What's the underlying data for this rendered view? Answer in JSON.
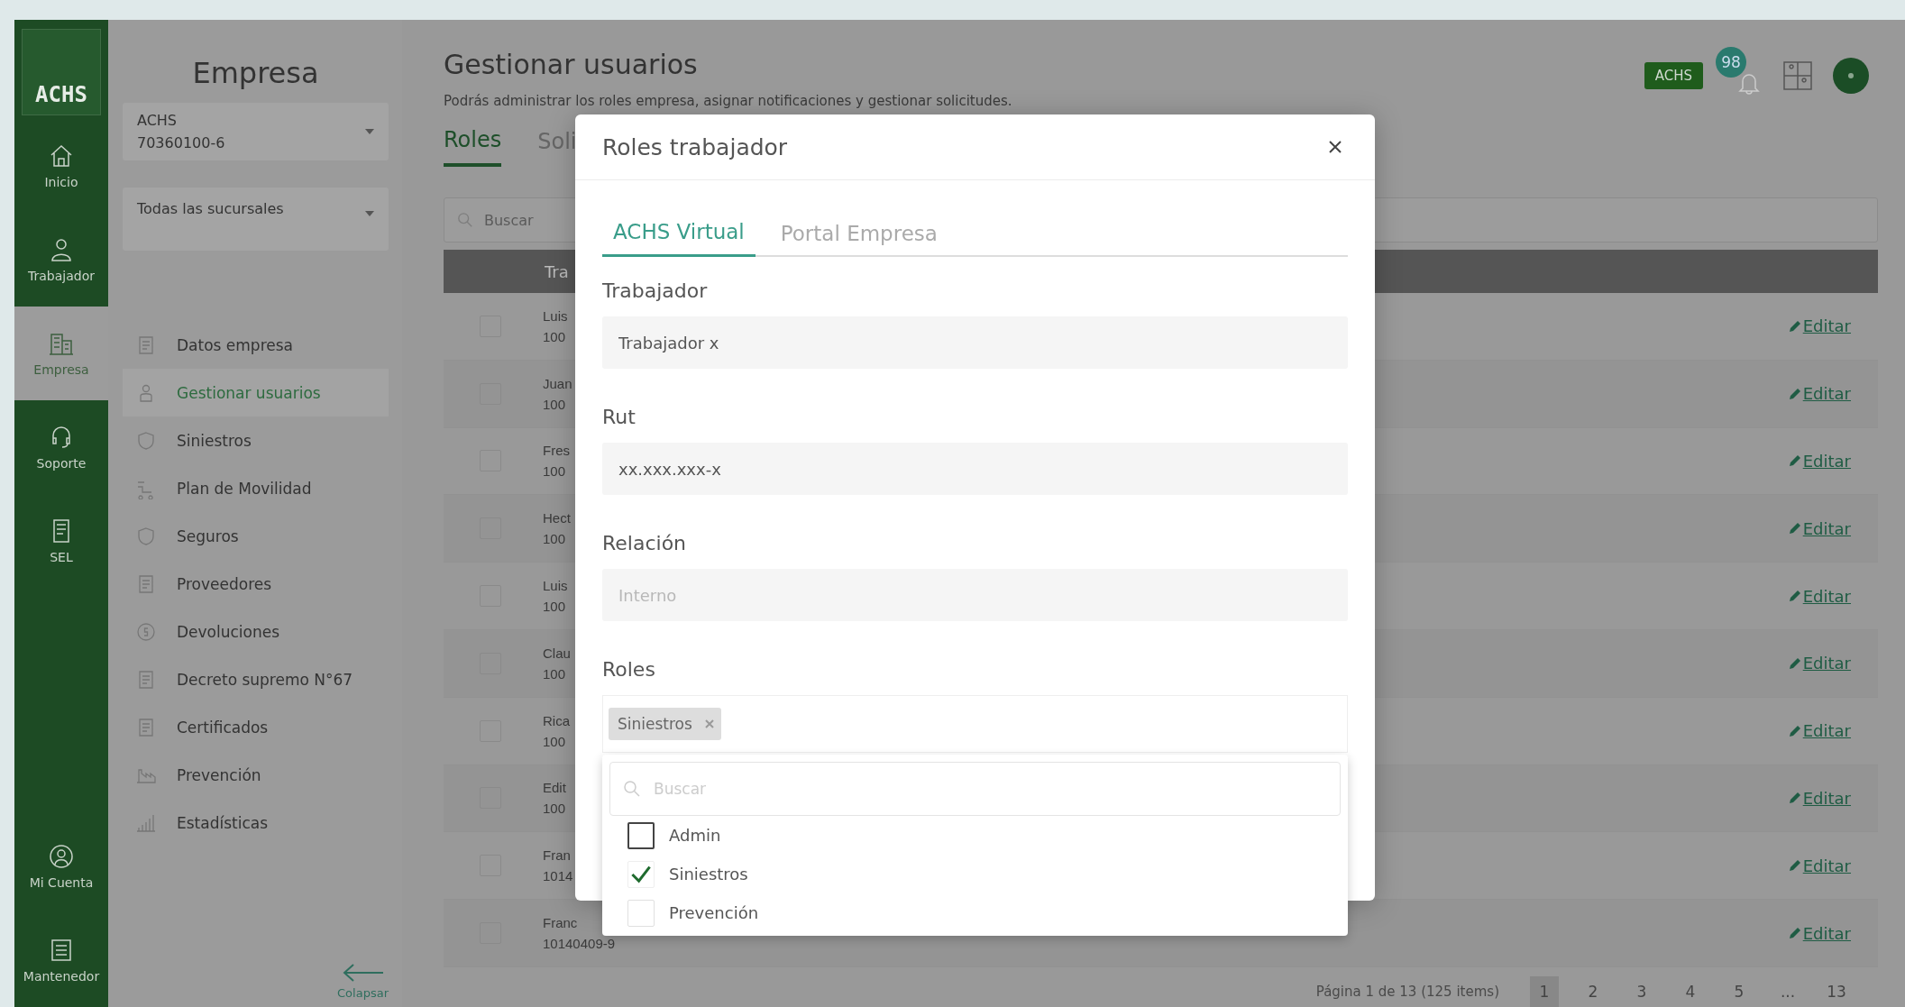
{
  "rail": {
    "logo": "ACHS",
    "items": [
      {
        "label": "Inicio",
        "selected": false
      },
      {
        "label": "Trabajador",
        "selected": false
      },
      {
        "label": "Empresa",
        "selected": true
      },
      {
        "label": "Soporte",
        "selected": false
      },
      {
        "label": "SEL",
        "selected": false
      }
    ],
    "bottom_items": [
      {
        "label": "Mi Cuenta",
        "selected": false
      },
      {
        "label": "Mantenedor",
        "selected": false
      }
    ]
  },
  "sidebar": {
    "title": "Empresa",
    "company_select": {
      "name": "ACHS",
      "rut": "70360100-6"
    },
    "branch_select": {
      "value": "Todas las sucursales"
    },
    "menu": [
      {
        "label": "Datos empresa",
        "selected": false
      },
      {
        "label": "Gestionar usuarios",
        "selected": true
      },
      {
        "label": "Siniestros",
        "selected": false
      },
      {
        "label": "Plan de Movilidad",
        "selected": false
      },
      {
        "label": "Seguros",
        "selected": false
      },
      {
        "label": "Proveedores",
        "selected": false
      },
      {
        "label": "Devoluciones",
        "selected": false
      },
      {
        "label": "Decreto supremo N°67",
        "selected": false
      },
      {
        "label": "Certificados",
        "selected": false
      },
      {
        "label": "Prevención",
        "selected": false
      },
      {
        "label": "Estadísticas",
        "selected": false
      }
    ],
    "collapse": "Colapsar"
  },
  "topbar": {
    "company_badge": "ACHS",
    "notifications": "98"
  },
  "page": {
    "title": "Gestionar usuarios",
    "subtitle": "Podrás administrar los roles empresa, asignar notificaciones y gestionar solicitudes.",
    "tabs": [
      {
        "label": "Roles",
        "selected": true
      },
      {
        "label": "Soli",
        "selected": false
      }
    ],
    "search": {
      "placeholder": "Buscar"
    },
    "table": {
      "columns": [
        "Tra"
      ],
      "rows": [
        {
          "checked": false,
          "name": "Luis",
          "rut": "100",
          "action": "Editar"
        },
        {
          "checked": false,
          "name": "Juan",
          "rut": "100",
          "action": "Editar"
        },
        {
          "checked": false,
          "name": "Fres",
          "rut": "100",
          "action": "Editar"
        },
        {
          "checked": false,
          "name": "Hect",
          "rut": "100",
          "action": "Editar"
        },
        {
          "checked": false,
          "name": "Luis",
          "rut": "100",
          "action": "Editar"
        },
        {
          "checked": false,
          "name": "Clau",
          "rut": "100",
          "action": "Editar"
        },
        {
          "checked": false,
          "name": "Rica",
          "rut": "100",
          "action": "Editar"
        },
        {
          "checked": false,
          "name": "Edit",
          "rut": "100",
          "action": "Editar"
        },
        {
          "checked": false,
          "name": "Fran",
          "rut": "1014",
          "action": "Editar"
        },
        {
          "checked": false,
          "name": "Franc",
          "rut": "10140409-9",
          "action": "Editar"
        }
      ]
    },
    "pagination": {
      "summary": "Página 1 de 13 (125 items)",
      "pages": [
        {
          "label": "1",
          "selected": true
        },
        {
          "label": "2",
          "selected": false
        },
        {
          "label": "3",
          "selected": false
        },
        {
          "label": "4",
          "selected": false
        },
        {
          "label": "5",
          "selected": false
        },
        {
          "label": "...",
          "selected": false
        },
        {
          "label": "13",
          "selected": false
        }
      ]
    }
  },
  "modal": {
    "title": "Roles trabajador",
    "tabs": [
      {
        "label": "ACHS Virtual",
        "selected": true
      },
      {
        "label": "Portal Empresa",
        "selected": false
      }
    ],
    "fields": [
      {
        "label": "Trabajador",
        "value": "Trabajador x"
      },
      {
        "label": "Rut",
        "value": "xx.xxx.xxx-x"
      },
      {
        "label": "Relación",
        "placeholder": "Interno"
      }
    ],
    "roles": {
      "label": "Roles",
      "chips": [
        "Siniestros"
      ],
      "search_placeholder": "Buscar",
      "options": [
        {
          "label": "Admin",
          "checked": false
        },
        {
          "label": "Siniestros",
          "checked": true
        },
        {
          "label": "Prevención",
          "checked": false
        }
      ]
    }
  }
}
